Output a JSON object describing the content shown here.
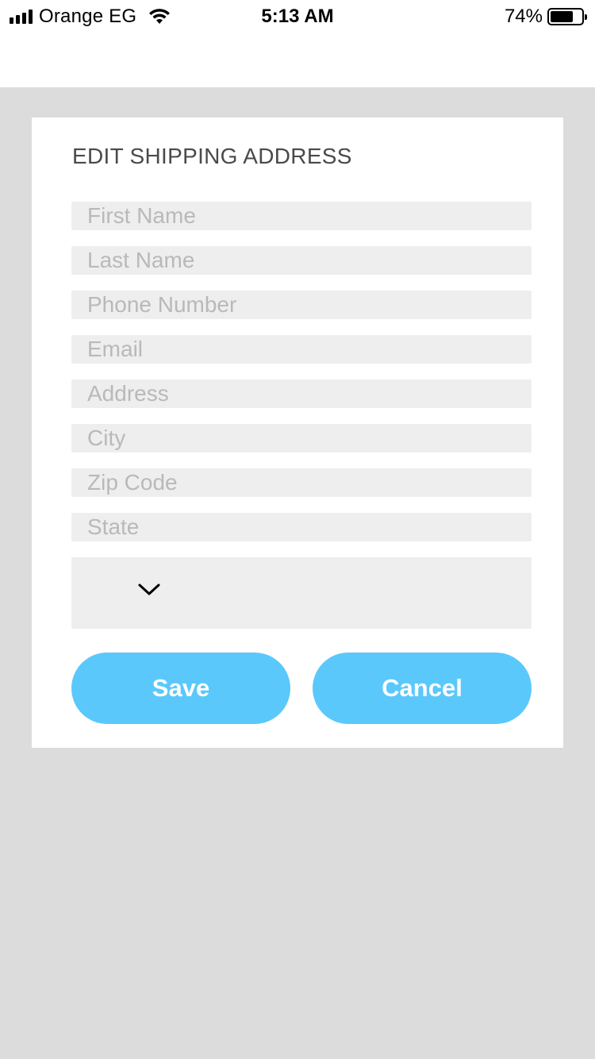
{
  "status_bar": {
    "carrier": "Orange EG",
    "time": "5:13 AM",
    "battery_percent": "74%",
    "battery_level": 0.74,
    "signal_icon": "signal-bars-icon",
    "wifi_icon": "wifi-icon",
    "battery_icon": "battery-icon"
  },
  "form": {
    "title": "EDIT SHIPPING ADDRESS",
    "fields": [
      {
        "placeholder": "First Name",
        "value": ""
      },
      {
        "placeholder": "Last Name",
        "value": ""
      },
      {
        "placeholder": "Phone Number",
        "value": ""
      },
      {
        "placeholder": "Email",
        "value": ""
      },
      {
        "placeholder": "Address",
        "value": ""
      },
      {
        "placeholder": "City",
        "value": ""
      },
      {
        "placeholder": "Zip Code",
        "value": ""
      },
      {
        "placeholder": "State",
        "value": ""
      }
    ],
    "dropdown": {
      "selected": "",
      "icon": "chevron-down-icon"
    },
    "save_label": "Save",
    "cancel_label": "Cancel"
  },
  "colors": {
    "accent": "#5bc8fb",
    "background": "#dcdcdc",
    "field_background": "#eeeeee",
    "title_text": "#4a4a4a",
    "placeholder_text": "#b9b9b9"
  }
}
